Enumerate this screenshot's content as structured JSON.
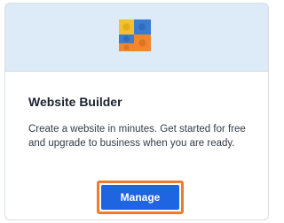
{
  "card": {
    "logo_icon": "lego-blocks-icon",
    "title": "Website Builder",
    "description": "Create a website in minutes. Get started for free and upgrade to business when you are ready.",
    "button_label": "Manage"
  },
  "colors": {
    "banner_bg": "#dcebf7",
    "button_bg": "#1f64e0",
    "button_highlight": "#f07c2b",
    "logo_orange": "#f2862c",
    "logo_blue": "#3a7dd0",
    "logo_yellow": "#f2c12e"
  }
}
